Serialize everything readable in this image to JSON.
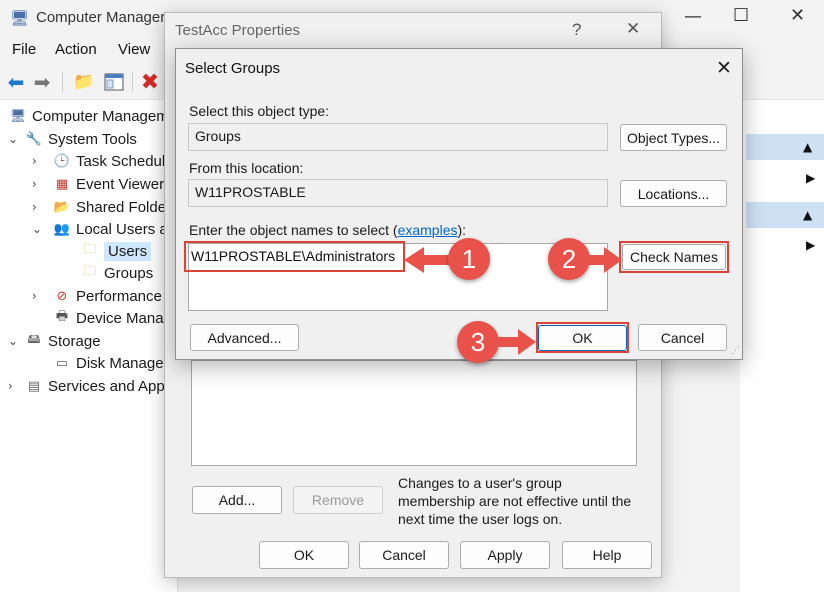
{
  "main_window": {
    "title": "Computer Manager",
    "menu": [
      "File",
      "Action",
      "View"
    ],
    "controls": {
      "minimize": "—",
      "maximize": "☐",
      "close": "✕"
    },
    "tree": [
      {
        "label": "Computer Managem",
        "icon": "computer-management-icon",
        "expand": ""
      },
      {
        "label": "System Tools",
        "icon": "tools-icon",
        "expand": "⌄"
      },
      {
        "label": "Task Schedul",
        "icon": "clock-icon",
        "expand": "›"
      },
      {
        "label": "Event Viewer",
        "icon": "event-viewer-icon",
        "expand": "›"
      },
      {
        "label": "Shared Folde",
        "icon": "shared-folder-icon",
        "expand": "›"
      },
      {
        "label": "Local Users a",
        "icon": "users-icon",
        "expand": "⌄"
      },
      {
        "label": "Users",
        "icon": "folder-icon",
        "expand": ""
      },
      {
        "label": "Groups",
        "icon": "folder-icon",
        "expand": ""
      },
      {
        "label": "Performance",
        "icon": "performance-icon",
        "expand": "›"
      },
      {
        "label": "Device Mana",
        "icon": "device-manager-icon",
        "expand": ""
      },
      {
        "label": "Storage",
        "icon": "storage-icon",
        "expand": "⌄"
      },
      {
        "label": "Disk Manage",
        "icon": "disk-icon",
        "expand": ""
      },
      {
        "label": "Services and App",
        "icon": "services-icon",
        "expand": "›"
      }
    ]
  },
  "properties_dialog": {
    "title": "TestAcc Properties",
    "help": "?",
    "close": "✕",
    "add_label": "Add...",
    "remove_label": "Remove",
    "note": "Changes to a user's group membership are not effective until the next time the user logs on.",
    "ok_label": "OK",
    "cancel_label": "Cancel",
    "apply_label": "Apply",
    "help_label": "Help"
  },
  "select_groups_dialog": {
    "title": "Select Groups",
    "close": "✕",
    "object_type_label": "Select this object type:",
    "object_type_value": "Groups",
    "object_types_button": "Object Types...",
    "location_label": "From this location:",
    "location_value": "W11PROSTABLE",
    "locations_button": "Locations...",
    "names_label_prefix": "Enter the object names to select (",
    "names_label_link": "examples",
    "names_label_suffix": "):",
    "names_value": "W11PROSTABLE\\Administrators",
    "check_names_button": "Check Names",
    "advanced_button": "Advanced...",
    "ok_button": "OK",
    "cancel_button": "Cancel"
  },
  "annotations": {
    "step1": "1",
    "step2": "2",
    "step3": "3",
    "color": "#e8524a"
  }
}
